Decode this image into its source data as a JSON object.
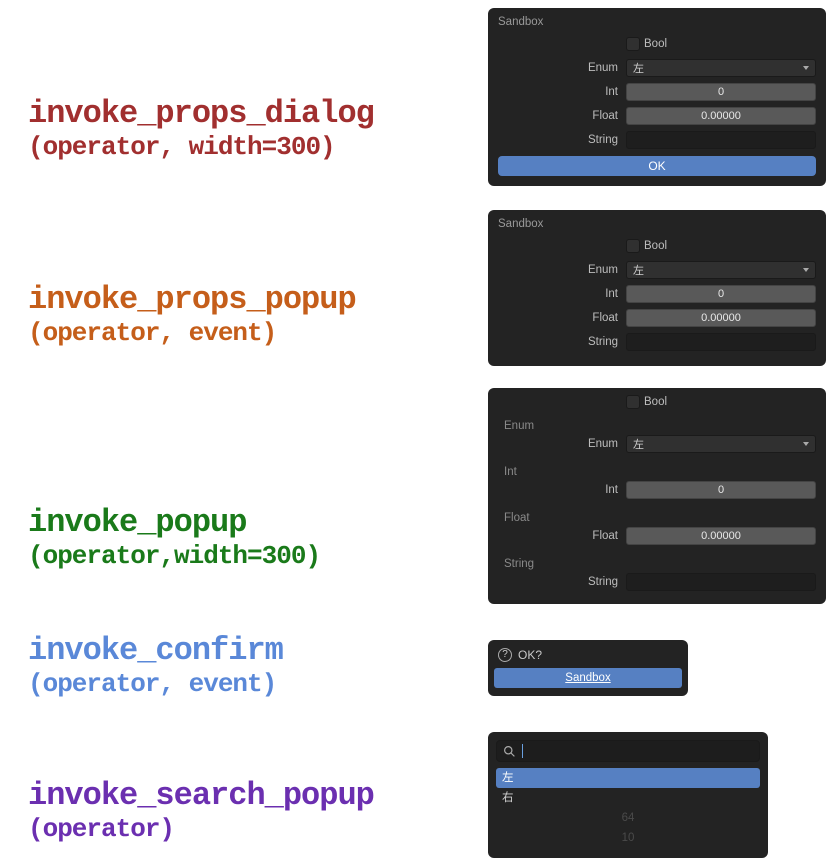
{
  "labels": {
    "bool": "Bool",
    "enum": "Enum",
    "int": "Int",
    "float": "Float",
    "string": "String"
  },
  "funcs": {
    "props_dialog": {
      "name": "invoke_props_dialog",
      "args": "(operator, width=300)"
    },
    "props_popup": {
      "name": "invoke_props_popup",
      "args": "(operator, event)"
    },
    "popup": {
      "name": "invoke_popup",
      "args": "(operator,width=300)"
    },
    "confirm": {
      "name": "invoke_confirm",
      "args": "(operator, event)"
    },
    "search": {
      "name": "invoke_search_popup",
      "args": "(operator)"
    }
  },
  "panel1": {
    "title": "Sandbox",
    "enum": "左",
    "int": "0",
    "float": "0.00000",
    "ok": "OK"
  },
  "panel2": {
    "title": "Sandbox",
    "enum": "左",
    "int": "0",
    "float": "0.00000"
  },
  "panel3": {
    "enum": "左",
    "int": "0",
    "float": "0.00000"
  },
  "confirm": {
    "title": "OK?",
    "button": "Sandbox"
  },
  "search": {
    "results": [
      "左",
      "右"
    ],
    "dims": [
      "64",
      "10"
    ]
  }
}
